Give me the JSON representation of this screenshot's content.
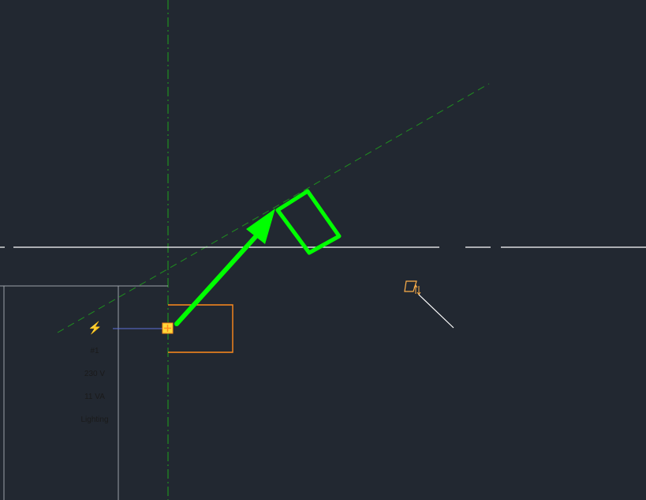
{
  "viewport": {
    "background": "#222831"
  },
  "circuit_panel": {
    "icon": "lightning-bolt-icon",
    "circuit_number": "#1",
    "voltage": "230 V",
    "load": "11 VA",
    "load_type": "Lighting"
  },
  "colors": {
    "green_axis": "#1f8f1f",
    "highlight_green": "#00ff00",
    "work_plane_line": "#ffffff",
    "element_outline": "#ff8a1c",
    "connector_line": "#5f6fd8",
    "grip_fill": "#ffd83a",
    "panel_border": "#9aa0a8"
  },
  "icons": {
    "grip": "square-grip-icon",
    "rotate_cursor": "rotate-cursor-icon",
    "arrow": "green-arrow-annotation"
  }
}
